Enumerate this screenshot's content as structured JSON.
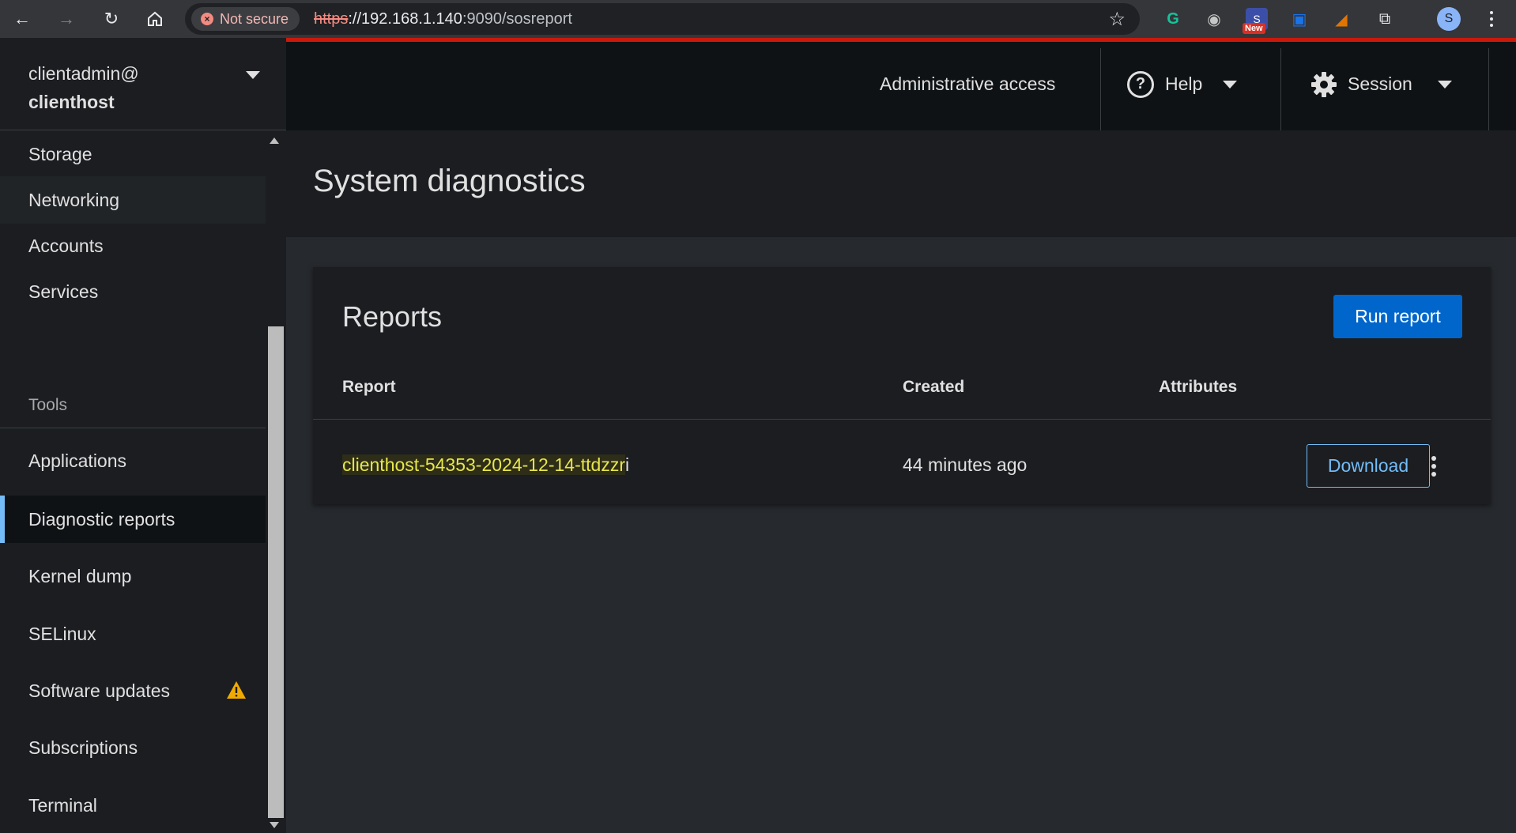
{
  "browser": {
    "security_label": "Not secure",
    "url_scheme": "https",
    "url_rest": "://192.168.1.140",
    "url_path": ":9090/sosreport",
    "ext_new_badge": "New",
    "profile_initial": "S"
  },
  "host": {
    "user": "clientadmin@",
    "name": "clienthost"
  },
  "masthead": {
    "admin_access": "Administrative access",
    "help_label": "Help",
    "session_label": "Session"
  },
  "sidebar": {
    "items": [
      {
        "label": "Storage"
      },
      {
        "label": "Networking"
      },
      {
        "label": "Accounts"
      },
      {
        "label": "Services"
      }
    ],
    "tools_heading": "Tools",
    "tools": [
      {
        "label": "Applications"
      },
      {
        "label": "Diagnostic reports"
      },
      {
        "label": "Kernel dump"
      },
      {
        "label": "SELinux"
      },
      {
        "label": "Software updates"
      },
      {
        "label": "Subscriptions"
      },
      {
        "label": "Terminal"
      }
    ],
    "active": "Diagnostic reports",
    "warning_on": "Software updates"
  },
  "page": {
    "title": "System diagnostics"
  },
  "reports_card": {
    "title": "Reports",
    "run_button": "Run report",
    "columns": [
      "Report",
      "Created",
      "Attributes"
    ],
    "rows": [
      {
        "name_highlighted": "clienthost-54353-2024-12-14-ttdzzr",
        "name_tail": "i",
        "created": "44 minutes ago",
        "action": "Download"
      }
    ]
  },
  "colors": {
    "accent": "#0066cc",
    "link": "#73bcf7",
    "highlight_text": "#e6e64c",
    "masthead_bg": "#0f1214",
    "warning": "#f0ab00"
  }
}
